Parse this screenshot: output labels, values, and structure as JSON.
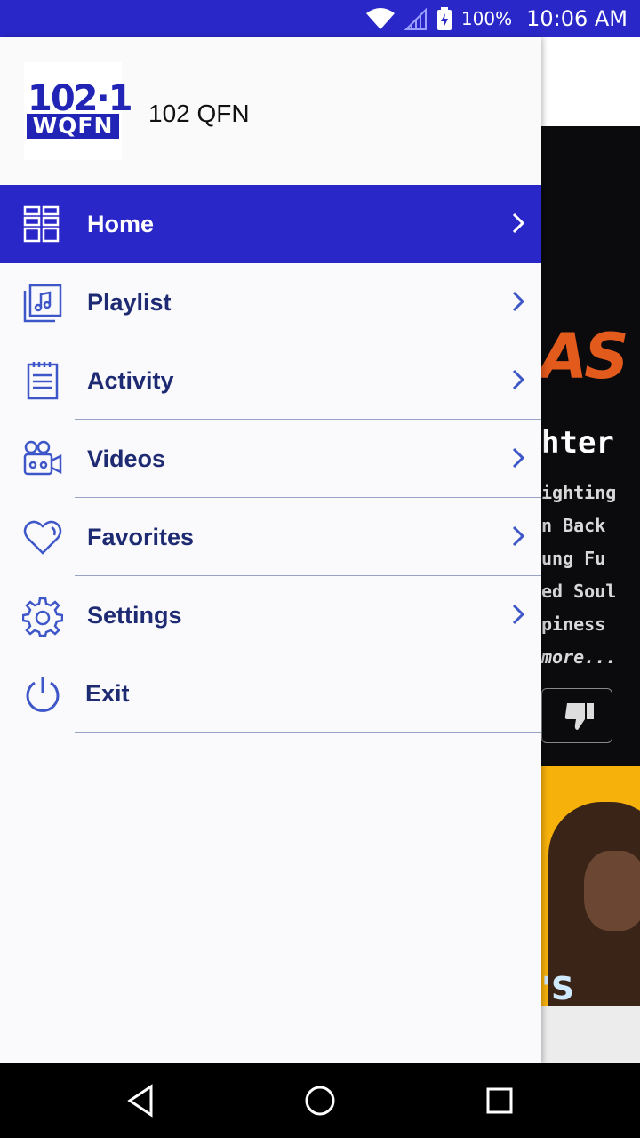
{
  "status_bar": {
    "battery_percent": "100%",
    "time": "10:06 AM"
  },
  "drawer": {
    "station_logo": {
      "number": "102·1",
      "callsign": "WQFN"
    },
    "station_name": "102 QFN",
    "items": [
      {
        "label": "Home",
        "icon": "grid-icon",
        "active": true
      },
      {
        "label": "Playlist",
        "icon": "music-note-icon"
      },
      {
        "label": "Activity",
        "icon": "notepad-icon"
      },
      {
        "label": "Videos",
        "icon": "video-camera-icon"
      },
      {
        "label": "Favorites",
        "icon": "heart-icon"
      },
      {
        "label": "Settings",
        "icon": "gear-icon"
      },
      {
        "label": "Exit",
        "icon": "power-icon"
      }
    ]
  },
  "background": {
    "title_fragment": "hter",
    "lines": [
      "ighting",
      "n Back",
      "ung Fu",
      "ed Soul",
      "piness",
      "more..."
    ],
    "promo_fragment": "'S"
  },
  "colors": {
    "accent": "#2a27c9",
    "menu_text": "#1e2b73",
    "icon": "#3e57c8"
  }
}
